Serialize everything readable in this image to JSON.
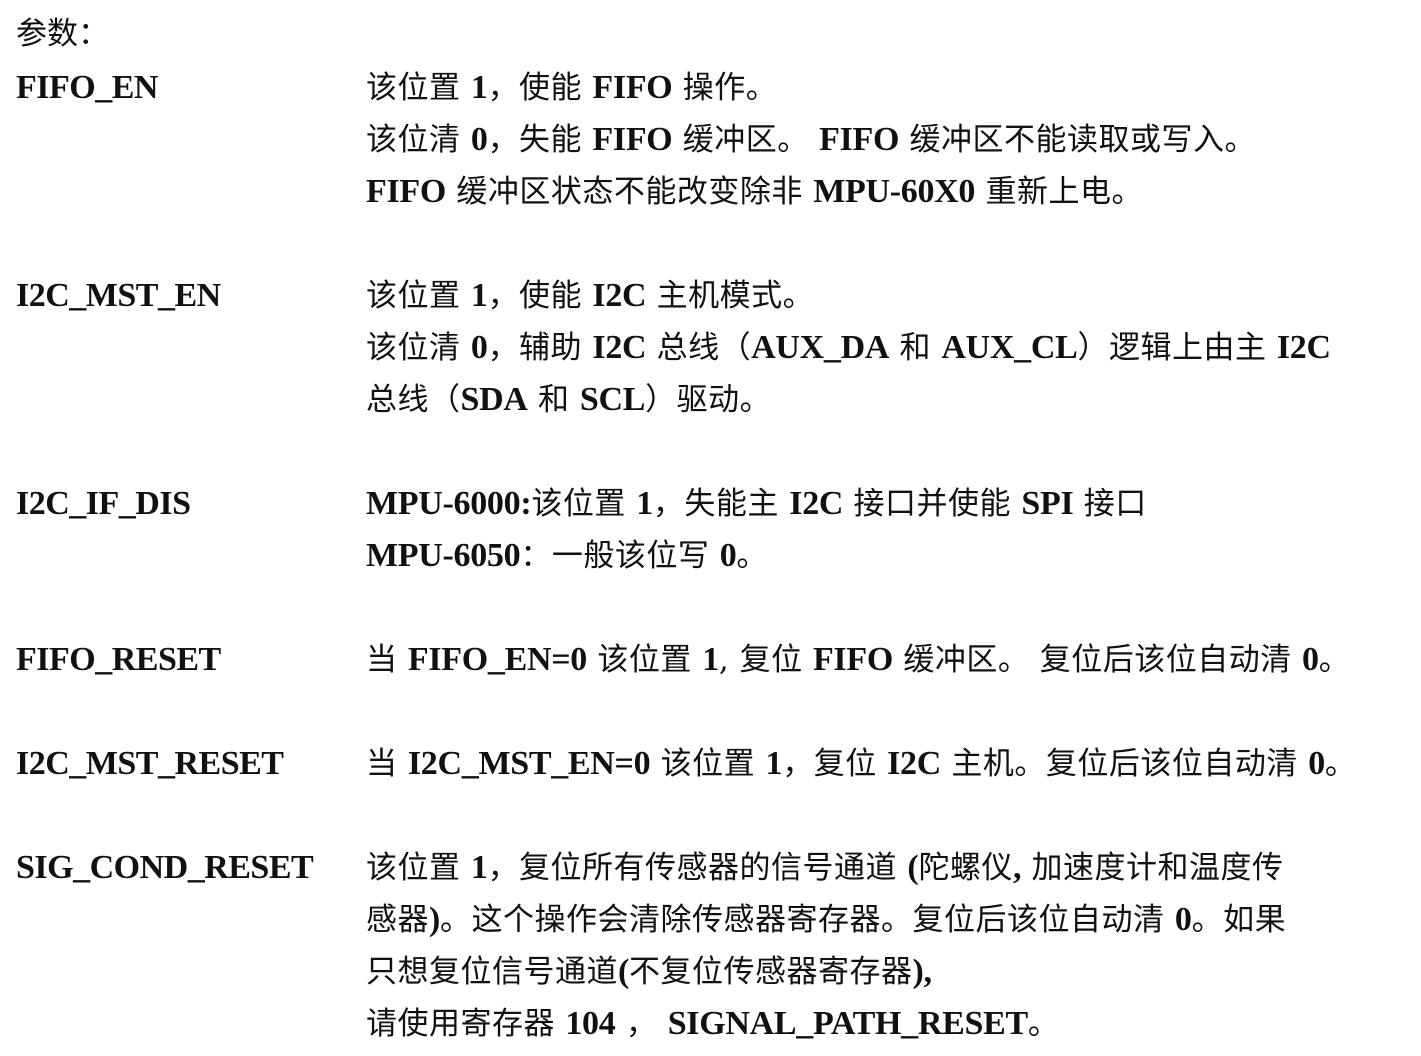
{
  "heading": "参数：",
  "params": [
    {
      "name": "FIFO_EN",
      "lines": [
        [
          "该位置 ",
          {
            "b": "1"
          },
          "，使能 ",
          {
            "b": "FIFO"
          },
          " 操作。"
        ],
        [
          "该位清 ",
          {
            "b": "0"
          },
          "，失能 ",
          {
            "b": "FIFO"
          },
          " 缓冲区。 ",
          {
            "b": "FIFO"
          },
          " 缓冲区不能读取或写入。"
        ],
        [
          {
            "b": "FIFO"
          },
          " 缓冲区状态不能改变除非 ",
          {
            "b": "MPU-60X0"
          },
          " 重新上电。"
        ]
      ]
    },
    {
      "name": "I2C_MST_EN",
      "lines": [
        [
          "该位置 ",
          {
            "b": "1"
          },
          "，使能 ",
          {
            "b": "I2C"
          },
          " 主机模式。"
        ],
        [
          "该位清 ",
          {
            "b": "0"
          },
          "，辅助 ",
          {
            "b": "I2C"
          },
          " 总线（",
          {
            "b": "AUX_DA"
          },
          " 和 ",
          {
            "b": "AUX_CL"
          },
          "）逻辑上由主 ",
          {
            "b": "I2C"
          }
        ],
        [
          "总线（",
          {
            "b": "SDA"
          },
          " 和 ",
          {
            "b": "SCL"
          },
          "）驱动。"
        ]
      ]
    },
    {
      "name": "I2C_IF_DIS",
      "lines": [
        [
          {
            "b": "MPU-6000:"
          },
          "该位置 ",
          {
            "b": "1"
          },
          "，失能主 ",
          {
            "b": "I2C"
          },
          " 接口并使能 ",
          {
            "b": "SPI"
          },
          " 接口"
        ],
        [
          {
            "b": "MPU-6050"
          },
          "：一般该位写 ",
          {
            "b": "0"
          },
          "。"
        ]
      ]
    },
    {
      "name": "FIFO_RESET",
      "lines": [
        [
          "当 ",
          {
            "b": "FIFO_EN=0"
          },
          " 该位置 ",
          {
            "b": "1"
          },
          ", 复位 ",
          {
            "b": "FIFO"
          },
          " 缓冲区。 复位后该位自动清 ",
          {
            "b": "0"
          },
          "。"
        ]
      ]
    },
    {
      "name": "I2C_MST_RESET",
      "lines": [
        [
          "当 ",
          {
            "b": "I2C_MST_EN=0"
          },
          " 该位置 ",
          {
            "b": "1"
          },
          "，复位 ",
          {
            "b": "I2C"
          },
          " 主机。复位后该位自动清 ",
          {
            "b": "0"
          },
          "。"
        ]
      ]
    },
    {
      "name": "SIG_COND_RESET",
      "lines": [
        [
          "该位置 ",
          {
            "b": "1"
          },
          "，复位所有传感器的信号通道 ",
          {
            "b": "("
          },
          "陀螺仪",
          {
            "b": ","
          },
          " 加速度计和温度传"
        ],
        [
          "感器",
          {
            "b": ")"
          },
          "。这个操作会清除传感器寄存器。复位后该位自动清 ",
          {
            "b": "0"
          },
          "。如果"
        ],
        [
          "只想复位信号通道",
          {
            "b": "("
          },
          "不复位传感器寄存器",
          {
            "b": "),"
          }
        ],
        [
          "请使用寄存器 ",
          {
            "b": "104"
          },
          " ， ",
          {
            "b": "SIGNAL_PATH_RESET"
          },
          "。"
        ]
      ]
    }
  ]
}
